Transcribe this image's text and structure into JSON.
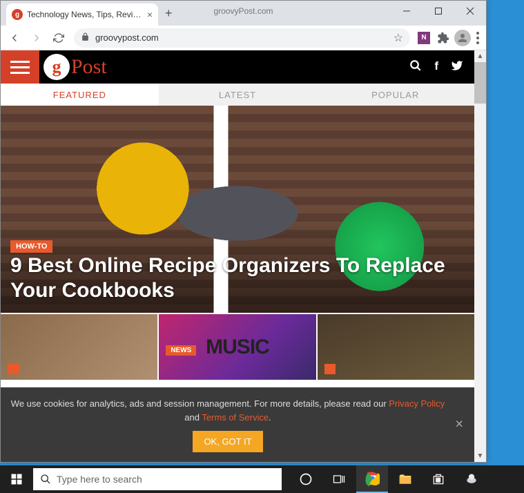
{
  "window": {
    "center_text": "groovyPost.com"
  },
  "tab": {
    "title": "Technology News, Tips, Reviews,"
  },
  "address": {
    "url": "groovypost.com"
  },
  "site": {
    "logo_text": "Post"
  },
  "tabs": {
    "featured": "FEATURED",
    "latest": "LATEST",
    "popular": "POPULAR"
  },
  "hero": {
    "badge": "HOW-TO",
    "title": "9 Best Online Recipe Organizers To Replace Your Cookbooks"
  },
  "thumbs": {
    "news_badge": "NEWS",
    "music_text": "MUSIC"
  },
  "cookie": {
    "pre": "We use cookies for analytics, ads and session management. For more details, please read our ",
    "privacy": "Privacy Policy",
    "and": " and ",
    "tos": "Terms of Service",
    "period": ".",
    "button": "OK, GOT IT"
  },
  "taskbar": {
    "search_placeholder": "Type here to search"
  }
}
